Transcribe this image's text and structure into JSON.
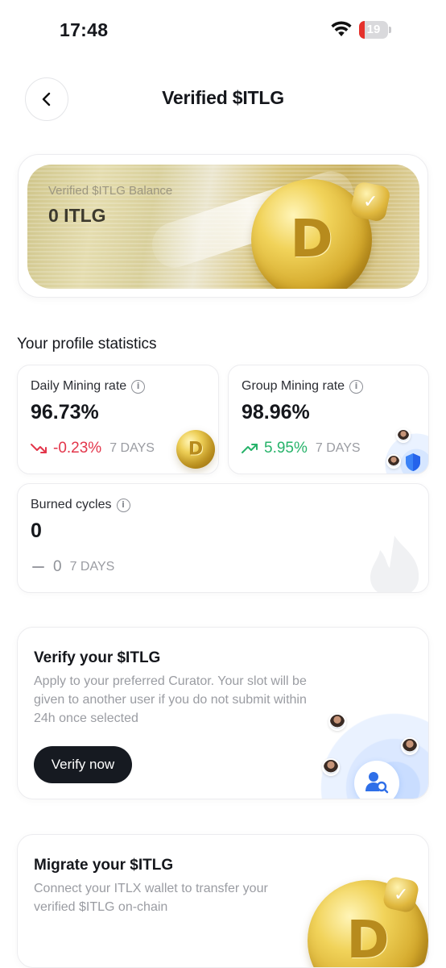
{
  "status_bar": {
    "time": "17:48",
    "battery_level": "19",
    "battery_fraction": 0.19
  },
  "header": {
    "title": "Verified $ITLG"
  },
  "balance_card": {
    "label": "Verified $ITLG Balance",
    "value": "0 ITLG",
    "coin_icon": "itlg-coin-icon",
    "badge_icon": "verified-check-icon"
  },
  "stats": {
    "section_title": "Your profile statistics",
    "daily_mining": {
      "label": "Daily Mining rate",
      "value": "96.73%",
      "change": "-0.23%",
      "period": "7 DAYS",
      "trend": "down",
      "color": "#e3354a"
    },
    "group_mining": {
      "label": "Group Mining rate",
      "value": "98.96%",
      "change": "5.95%",
      "period": "7 DAYS",
      "trend": "up",
      "color": "#27b36a"
    },
    "burned_cycles": {
      "label": "Burned cycles",
      "value": "0",
      "change": "0",
      "period": "7 DAYS",
      "trend": "flat",
      "color": "#8f9298"
    }
  },
  "verify_card": {
    "title": "Verify your $ITLG",
    "description": "Apply to your preferred Curator. Your slot will be given to another user if you do not submit within 24h once selected",
    "button_label": "Verify now"
  },
  "migrate_card": {
    "title": "Migrate your $ITLG",
    "description": "Connect your ITLX wallet to transfer your verified $ITLG on-chain"
  },
  "colors": {
    "accent_dark": "#161a21",
    "gold": "#d4a92c",
    "blue": "#2f7cf6"
  }
}
